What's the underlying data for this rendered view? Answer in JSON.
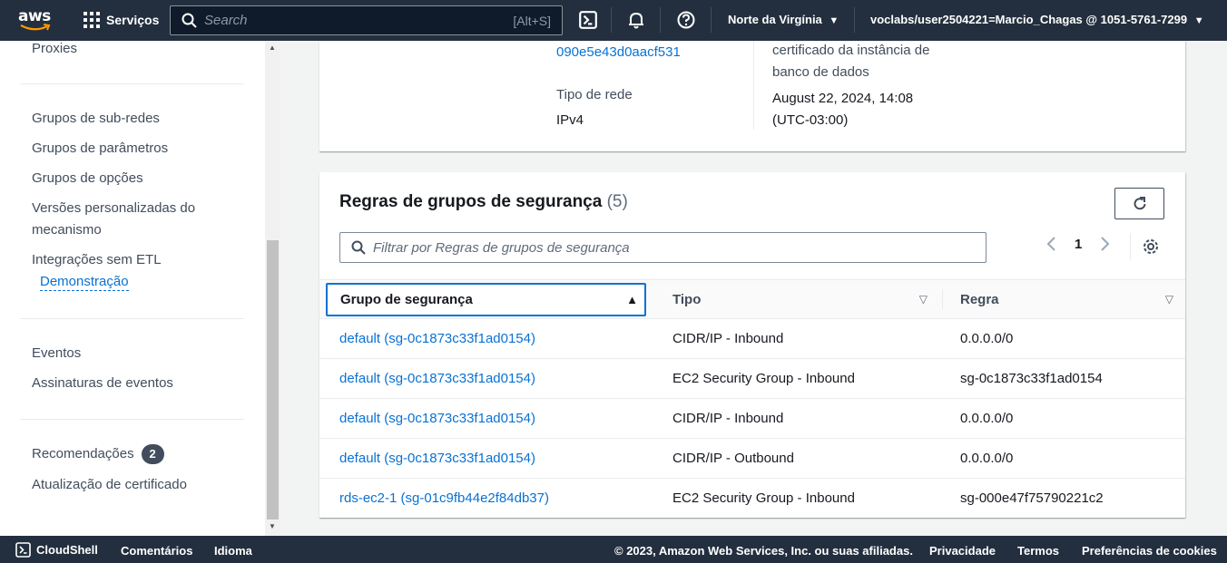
{
  "topnav": {
    "logo_text": "aws",
    "services_label": "Serviços",
    "search_placeholder": "Search",
    "search_shortcut": "[Alt+S]",
    "region": "Norte da Virgínia",
    "account": "voclabs/user2504221=Marcio_Chagas @ 1051-5761-7299"
  },
  "sidebar": {
    "items": [
      "Proxies",
      "Grupos de sub-redes",
      "Grupos de parâmetros",
      "Grupos de opções",
      "Versões personalizadas do",
      "mecanismo",
      "Integrações sem ETL",
      "Demonstração",
      "Eventos",
      "Assinaturas de eventos",
      "Recomendações",
      "Atualização de certificado"
    ],
    "recommendations_count": "2"
  },
  "details": {
    "vpc_id": "090e5e43d0aacf531",
    "network_type_label": "Tipo de rede",
    "network_type_value": "IPv4",
    "cert_line1": "certificado da instância de",
    "cert_line2": "banco de dados",
    "cert_date": "August 22, 2024, 14:08",
    "cert_tz": "(UTC-03:00)"
  },
  "security_rules": {
    "title": "Regras de grupos de segurança",
    "count": "(5)",
    "filter_placeholder": "Filtrar por Regras de grupos de segurança",
    "page": "1",
    "columns": [
      "Grupo de segurança",
      "Tipo",
      "Regra"
    ],
    "rows": [
      {
        "group": "default (sg-0c1873c33f1ad0154)",
        "type": "CIDR/IP - Inbound",
        "rule": "0.0.0.0/0"
      },
      {
        "group": "default (sg-0c1873c33f1ad0154)",
        "type": "EC2 Security Group - Inbound",
        "rule": "sg-0c1873c33f1ad0154"
      },
      {
        "group": "default (sg-0c1873c33f1ad0154)",
        "type": "CIDR/IP - Inbound",
        "rule": "0.0.0.0/0"
      },
      {
        "group": "default (sg-0c1873c33f1ad0154)",
        "type": "CIDR/IP - Outbound",
        "rule": "0.0.0.0/0"
      },
      {
        "group": "rds-ec2-1 (sg-01c9fb44e2f84db37)",
        "type": "EC2 Security Group - Inbound",
        "rule": "sg-000e47f75790221c2"
      }
    ]
  },
  "footer": {
    "cloudshell": "CloudShell",
    "feedback": "Comentários",
    "language": "Idioma",
    "copyright": "© 2023, Amazon Web Services, Inc. ou suas afiliadas.",
    "privacy": "Privacidade",
    "terms": "Termos",
    "cookies": "Preferências de cookies"
  },
  "colors": {
    "nav_bg": "#232f3e",
    "link": "#0972d3",
    "page_bg": "#f2f3f3"
  },
  "icons": [
    "grid-icon",
    "search-icon",
    "cloudshell-icon",
    "bell-icon",
    "help-icon",
    "caret-down-icon",
    "refresh-icon",
    "chevron-left-icon",
    "chevron-right-icon",
    "gear-icon",
    "sort-ascending-icon",
    "sort-icon"
  ]
}
